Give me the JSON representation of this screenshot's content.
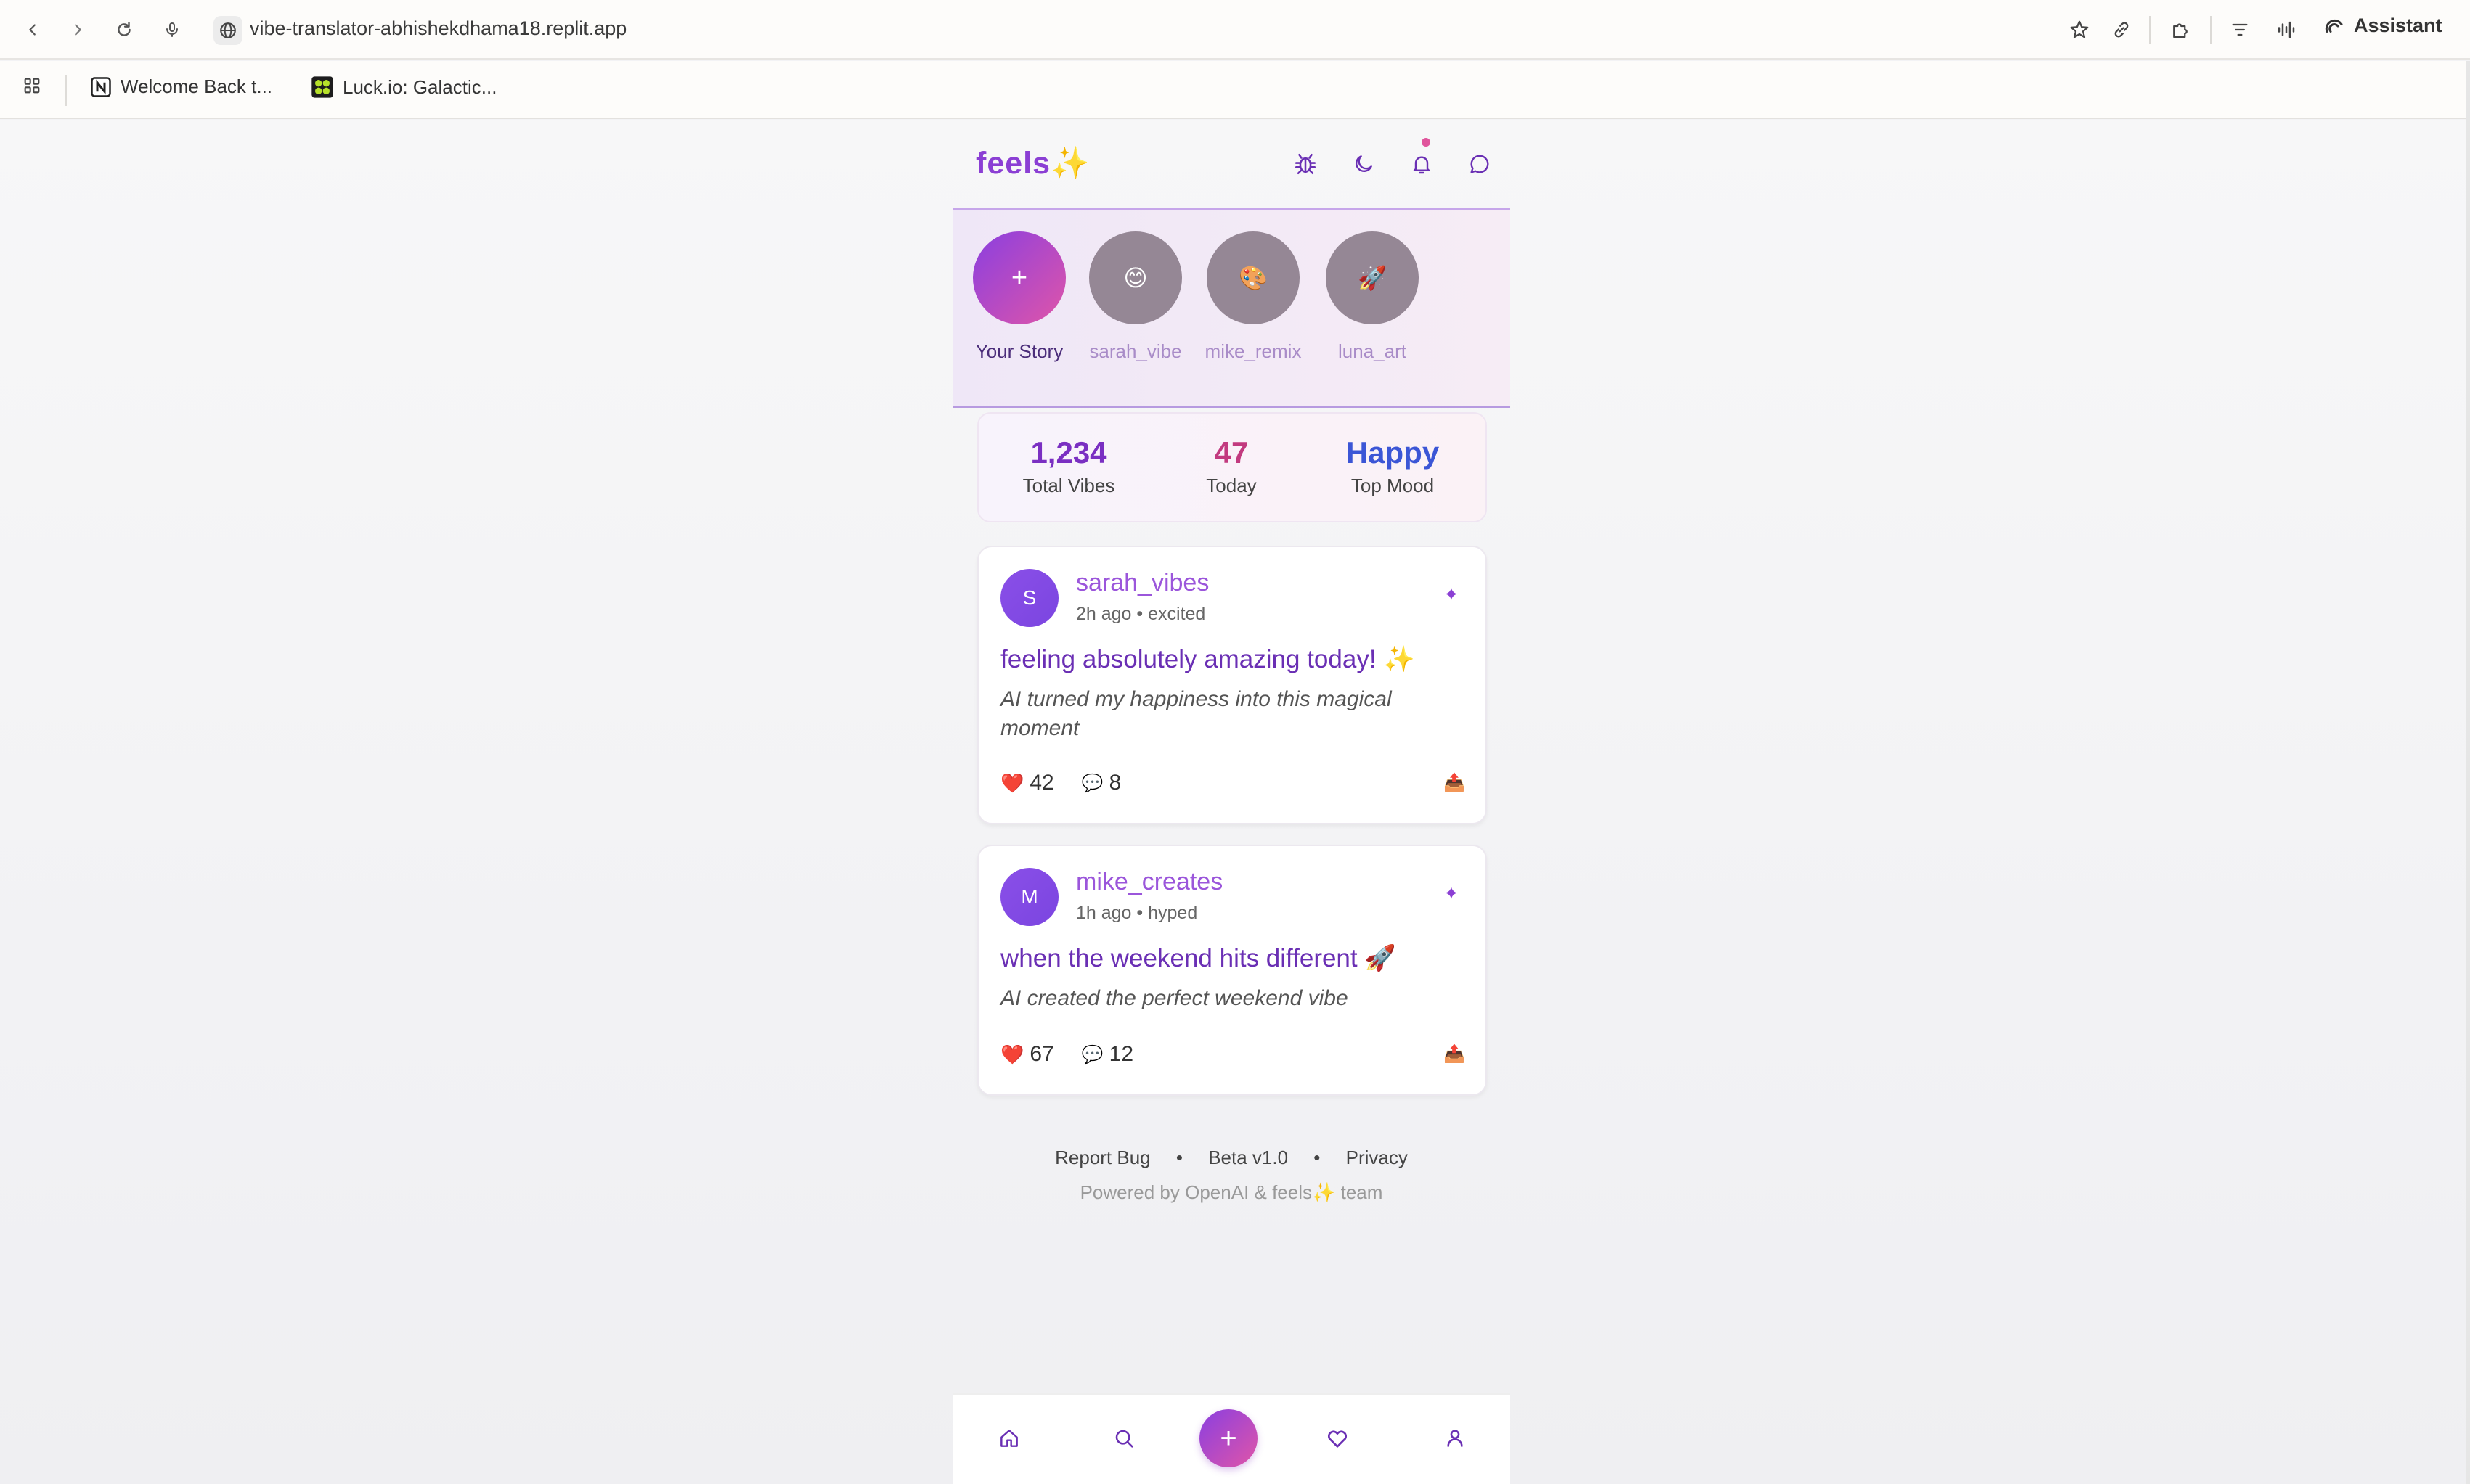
{
  "browser": {
    "url": "vibe-translator-abhishekdhama18.replit.app",
    "assistant_label": "Assistant",
    "bookmarks": [
      {
        "label": "Welcome Back t..."
      },
      {
        "label": "Luck.io: Galactic..."
      }
    ]
  },
  "app": {
    "logo": "feels✨",
    "header_icons": [
      "bug-icon",
      "moon-icon",
      "bell-icon",
      "chat-icon"
    ]
  },
  "stories": [
    {
      "label": "Your Story",
      "symbol": "+",
      "own": true
    },
    {
      "label": "sarah_vibe",
      "symbol": "😊",
      "own": false
    },
    {
      "label": "mike_remix",
      "symbol": "🎨",
      "own": false
    },
    {
      "label": "luna_art",
      "symbol": "🚀",
      "own": false
    }
  ],
  "stats": [
    {
      "value": "1,234",
      "label": "Total Vibes",
      "color": "#7a2fc2"
    },
    {
      "value": "47",
      "label": "Today",
      "color": "#c23a7f"
    },
    {
      "value": "Happy",
      "label": "Top Mood",
      "color": "#3b56d6"
    }
  ],
  "posts": [
    {
      "initial": "S",
      "username": "sarah_vibes",
      "meta": "2h ago • excited",
      "spark": "✦",
      "title": "feeling absolutely amazing today! ✨",
      "description": "AI turned my happiness into this magical moment",
      "like_icon": "❤️",
      "likes": "42",
      "comment_icon": "💬",
      "comments": "8",
      "share_icon": "📤"
    },
    {
      "initial": "M",
      "username": "mike_creates",
      "meta": "1h ago • hyped",
      "spark": "✦",
      "title": "when the weekend hits different 🚀",
      "description": "AI created the perfect weekend vibe",
      "like_icon": "❤️",
      "likes": "67",
      "comment_icon": "💬",
      "comments": "12",
      "share_icon": "📤"
    }
  ],
  "footer": {
    "links": [
      "Report Bug",
      "Beta v1.0",
      "Privacy"
    ],
    "separator": "•",
    "powered": "Powered by OpenAI & feels✨ team"
  },
  "bottom_nav": {
    "items": [
      "home-icon",
      "search-icon",
      "create-button",
      "heart-icon",
      "profile-icon"
    ],
    "fab_label": "+"
  }
}
